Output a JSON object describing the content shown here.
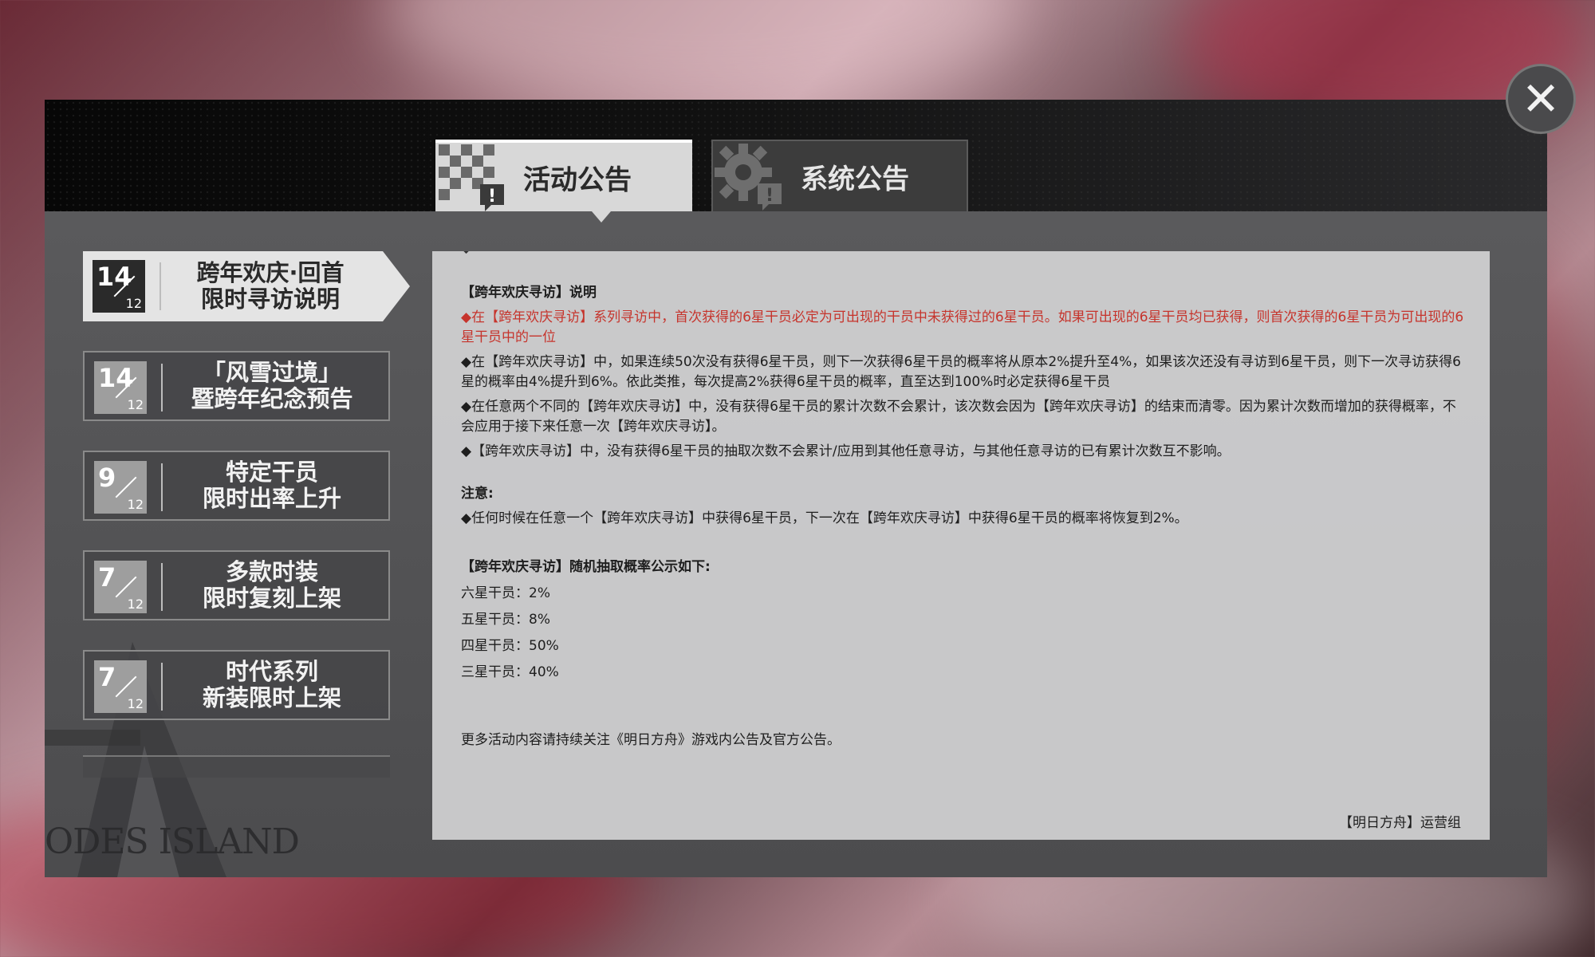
{
  "tabs": {
    "activity_label": "活动公告",
    "system_label": "系统公告"
  },
  "sidebar": {
    "items": [
      {
        "day": "14",
        "month": "12",
        "title_line1": "跨年欢庆·回首",
        "title_line2": "限时寻访说明"
      },
      {
        "day": "14",
        "month": "12",
        "title_line1": "「风雪过境」",
        "title_line2": "暨跨年纪念预告"
      },
      {
        "day": "9",
        "month": "12",
        "title_line1": "特定干员",
        "title_line2": "限时出率上升"
      },
      {
        "day": "7",
        "month": "12",
        "title_line1": "多款时装",
        "title_line2": "限时复刻上架"
      },
      {
        "day": "7",
        "month": "12",
        "title_line1": "时代系列",
        "title_line2": "新装限时上架"
      }
    ]
  },
  "content": {
    "section_title": "【跨年欢庆寻访】说明",
    "para_red": "◆在【跨年欢庆寻访】系列寻访中，首次获得的6星干员必定为可出现的干员中未获得过的6星干员。如果可出现的6星干员均已获得，则首次获得的6星干员为可出现的6星干员中的一位",
    "para_2": "◆在【跨年欢庆寻访】中，如果连续50次没有获得6星干员，则下一次获得6星干员的概率将从原本2%提升至4%，如果该次还没有寻访到6星干员，则下一次寻访获得6星的概率由4%提升到6%。依此类推，每次提高2%获得6星干员的概率，直至达到100%时必定获得6星干员",
    "para_3": "◆在任意两个不同的【跨年欢庆寻访】中，没有获得6星干员的累计次数不会累计，该次数会因为【跨年欢庆寻访】的结束而清零。因为累计次数而增加的获得概率，不会应用于接下来任意一次【跨年欢庆寻访】。",
    "para_4": "◆【跨年欢庆寻访】中，没有获得6星干员的抽取次数不会累计/应用到其他任意寻访，与其他任意寻访的已有累计次数互不影响。",
    "note_label": "注意:",
    "note_text": "◆任何时候在任意一个【跨年欢庆寻访】中获得6星干员，下一次在【跨年欢庆寻访】中获得6星干员的概率将恢复到2%。",
    "rates_title": "【跨年欢庆寻访】随机抽取概率公示如下:",
    "rates": [
      "六星干员：2%",
      "五星干员：8%",
      "四星干员：50%",
      "三星干员：40%"
    ],
    "footer": "更多活动内容请持续关注《明日方舟》游戏内公告及官方公告。",
    "signature": "【明日方舟】运营组"
  },
  "emblem_text": "ODES ISLAND",
  "colors": {
    "red_text": "#c6342c",
    "active_tab": "#d8d8d8",
    "panel": "#4b4b4d"
  }
}
